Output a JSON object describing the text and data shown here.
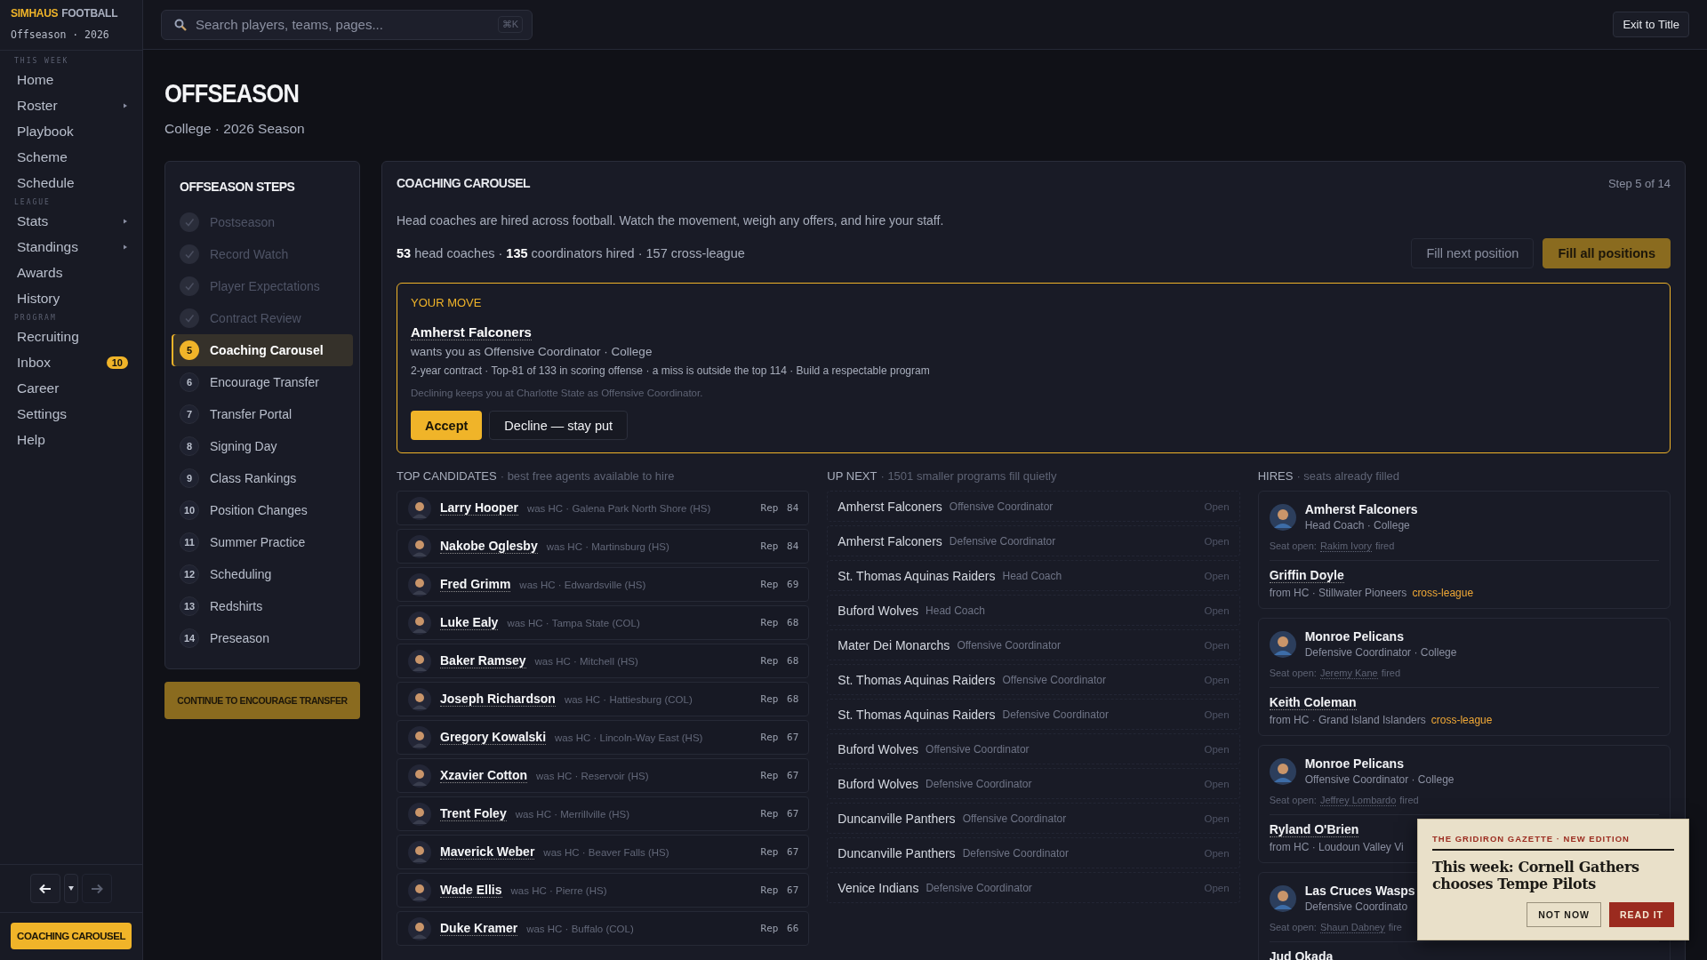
{
  "brand": {
    "name_accent": "SIMHAUS",
    "name_rest": "FOOTBALL",
    "subtitle": "Offseason · 2026"
  },
  "sidebar": {
    "sections": [
      {
        "label": "THIS WEEK",
        "items": [
          {
            "label": "Home",
            "submenu": false
          },
          {
            "label": "Roster",
            "submenu": true
          },
          {
            "label": "Playbook",
            "submenu": false
          },
          {
            "label": "Scheme",
            "submenu": false
          },
          {
            "label": "Schedule",
            "submenu": false
          }
        ]
      },
      {
        "label": "LEAGUE",
        "items": [
          {
            "label": "Stats",
            "submenu": true
          },
          {
            "label": "Standings",
            "submenu": true
          },
          {
            "label": "Awards",
            "submenu": false
          },
          {
            "label": "History",
            "submenu": false
          }
        ]
      },
      {
        "label": "PROGRAM",
        "items": [
          {
            "label": "Recruiting",
            "submenu": false
          },
          {
            "label": "Inbox",
            "submenu": false,
            "badge": "10"
          },
          {
            "label": "Career",
            "submenu": false
          },
          {
            "label": "Settings",
            "submenu": false
          },
          {
            "label": "Help",
            "submenu": false
          }
        ]
      }
    ],
    "history_nav": {
      "back_disabled": false,
      "forward_disabled": true
    },
    "current_page": "COACHING CAROUSEL"
  },
  "topbar": {
    "search": {
      "placeholder": "Search players, teams, pages...",
      "shortcut": "⌘K"
    },
    "exit_button": "Exit to Title"
  },
  "page": {
    "title": "OFFSEASON",
    "subtitle": "College · 2026 Season"
  },
  "steps": {
    "title": "OFFSEASON STEPS",
    "items": [
      {
        "label": "Postseason",
        "done": true,
        "selected": false
      },
      {
        "label": "Record Watch",
        "done": true,
        "selected": false
      },
      {
        "label": "Player Expectations",
        "done": true,
        "selected": false
      },
      {
        "label": "Contract Review",
        "done": true,
        "selected": false
      },
      {
        "number": "5",
        "label": "Coaching Carousel",
        "done": false,
        "selected": true
      },
      {
        "number": "6",
        "label": "Encourage Transfer",
        "done": false,
        "selected": false
      },
      {
        "number": "7",
        "label": "Transfer Portal",
        "done": false,
        "selected": false
      },
      {
        "number": "8",
        "label": "Signing Day",
        "done": false,
        "selected": false
      },
      {
        "number": "9",
        "label": "Class Rankings",
        "done": false,
        "selected": false
      },
      {
        "number": "10",
        "label": "Position Changes",
        "done": false,
        "selected": false
      },
      {
        "number": "11",
        "label": "Summer Practice",
        "done": false,
        "selected": false
      },
      {
        "number": "12",
        "label": "Scheduling",
        "done": false,
        "selected": false
      },
      {
        "number": "13",
        "label": "Redshirts",
        "done": false,
        "selected": false
      },
      {
        "number": "14",
        "label": "Preseason",
        "done": false,
        "selected": false
      }
    ],
    "continue_button": "CONTINUE TO ENCOURAGE TRANSFER"
  },
  "carousel": {
    "title": "COACHING CAROUSEL",
    "step": "Step 5 of 14",
    "description": "Head coaches are hired across football. Watch the movement, weigh any offers, and hire your staff.",
    "stats": "**53** head coaches · **135** coordinators hired · 157 cross-league",
    "buttons": [
      {
        "label": "Fill next position",
        "kind": "secondary"
      },
      {
        "label": "Fill all positions",
        "kind": "primary"
      }
    ],
    "your_move": {
      "label": "YOUR MOVE",
      "team": "Amherst Falconers",
      "role": "wants you as Offensive Coordinator · College",
      "details": "2-year contract · Top-81 of 133 in scoring offense · a miss is outside the top 114 · Build a respectable program",
      "note": "Declining keeps you at Charlotte State as Offensive Coordinator.",
      "accept": "Accept",
      "decline": "Decline — stay put"
    },
    "candidates": {
      "heading": "TOP CANDIDATES",
      "subheading": "· best free agents available to hire",
      "rows": [
        {
          "name": "Larry Hooper",
          "from": "was HC · Galena Park North Shore (HS)",
          "rep": "Rep 84"
        },
        {
          "name": "Nakobe Oglesby",
          "from": "was HC · Martinsburg (HS)",
          "rep": "Rep 84"
        },
        {
          "name": "Fred Grimm",
          "from": "was HC · Edwardsville (HS)",
          "rep": "Rep 69"
        },
        {
          "name": "Luke Ealy",
          "from": "was HC · Tampa State (COL)",
          "rep": "Rep 68"
        },
        {
          "name": "Baker Ramsey",
          "from": "was HC · Mitchell (HS)",
          "rep": "Rep 68"
        },
        {
          "name": "Joseph Richardson",
          "from": "was HC · Hattiesburg (COL)",
          "rep": "Rep 68"
        },
        {
          "name": "Gregory Kowalski",
          "from": "was HC · Lincoln-Way East (HS)",
          "rep": "Rep 67"
        },
        {
          "name": "Xzavier Cotton",
          "from": "was HC · Reservoir (HS)",
          "rep": "Rep 67"
        },
        {
          "name": "Trent Foley",
          "from": "was HC · Merrillville (HS)",
          "rep": "Rep 67"
        },
        {
          "name": "Maverick Weber",
          "from": "was HC · Beaver Falls (HS)",
          "rep": "Rep 67"
        },
        {
          "name": "Wade Ellis",
          "from": "was HC · Pierre (HS)",
          "rep": "Rep 67"
        },
        {
          "name": "Duke Kramer",
          "from": "was HC · Buffalo (COL)",
          "rep": "Rep 66"
        }
      ]
    },
    "up_next": {
      "heading": "UP NEXT",
      "subheading": "· 1501 smaller programs fill quietly",
      "rows": [
        {
          "team": "Amherst Falconers",
          "role": "Offensive Coordinator",
          "status": "Open"
        },
        {
          "team": "Amherst Falconers",
          "role": "Defensive Coordinator",
          "status": "Open"
        },
        {
          "team": "St. Thomas Aquinas Raiders",
          "role": "Head Coach",
          "status": "Open"
        },
        {
          "team": "Buford Wolves",
          "role": "Head Coach",
          "status": "Open"
        },
        {
          "team": "Mater Dei Monarchs",
          "role": "Offensive Coordinator",
          "status": "Open"
        },
        {
          "team": "St. Thomas Aquinas Raiders",
          "role": "Offensive Coordinator",
          "status": "Open"
        },
        {
          "team": "St. Thomas Aquinas Raiders",
          "role": "Defensive Coordinator",
          "status": "Open"
        },
        {
          "team": "Buford Wolves",
          "role": "Offensive Coordinator",
          "status": "Open"
        },
        {
          "team": "Buford Wolves",
          "role": "Defensive Coordinator",
          "status": "Open"
        },
        {
          "team": "Duncanville Panthers",
          "role": "Offensive Coordinator",
          "status": "Open"
        },
        {
          "team": "Duncanville Panthers",
          "role": "Defensive Coordinator",
          "status": "Open"
        },
        {
          "team": "Venice Indians",
          "role": "Defensive Coordinator",
          "status": "Open"
        }
      ]
    },
    "hires": {
      "heading": "HIRES",
      "subheading": "· seats already filled",
      "cards": [
        {
          "team": "Amherst Falconers",
          "role": "Head Coach · College",
          "seat_label": "Seat open:",
          "seat_name": "Rakim Ivory",
          "seat_suffix": "fired",
          "hire_name": "Griffin Doyle",
          "hire_from": "from HC · Stillwater Pioneers",
          "cross_league": "cross-league"
        },
        {
          "team": "Monroe Pelicans",
          "role": "Defensive Coordinator · College",
          "seat_label": "Seat open:",
          "seat_name": "Jeremy Kane",
          "seat_suffix": "fired",
          "hire_name": "Keith Coleman",
          "hire_from": "from HC · Grand Island Islanders",
          "cross_league": "cross-league"
        },
        {
          "team": "Monroe Pelicans",
          "role": "Offensive Coordinator · College",
          "seat_label": "Seat open:",
          "seat_name": "Jeffrey Lombardo",
          "seat_suffix": "fired",
          "hire_name": "Ryland O'Brien",
          "hire_from": "from HC · Loudoun Valley Vi"
        },
        {
          "team": "Las Cruces Wasps",
          "role": "Defensive Coordinato",
          "seat_label": "Seat open:",
          "seat_name": "Shaun Dabney",
          "seat_suffix": "fire",
          "hire_name": "Jud Okada"
        }
      ]
    }
  },
  "gazette": {
    "kicker": "THE GRIDIRON GAZETTE · NEW EDITION",
    "headline": "This week: Cornell Gathers chooses Tempe Pilots",
    "dismiss": "NOT NOW",
    "read": "READ IT"
  }
}
